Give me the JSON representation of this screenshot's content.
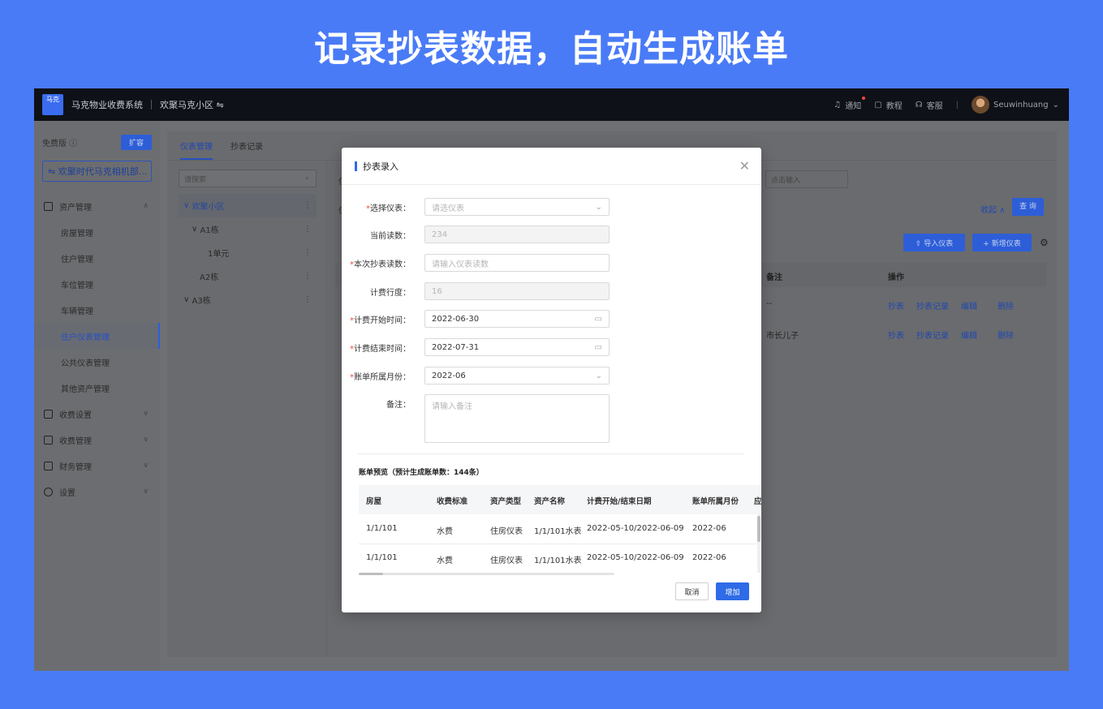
{
  "headline": "记录抄表数据，自动生成账单",
  "topbar": {
    "logo_text": "马克",
    "system_name": "马克物业收费系统",
    "community": "欢聚马克小区 ⇋",
    "notify": "通知",
    "tutorial": "教程",
    "service": "客服",
    "user": "Seuwinhuang"
  },
  "sidebar": {
    "plan": "免费版",
    "expand_btn": "扩容",
    "community_btn": "⇋ 欢聚时代马克相机部...",
    "groups": [
      {
        "label": "资产管理",
        "items": [
          "房屋管理",
          "住户管理",
          "车位管理",
          "车辆管理",
          "住户仪表管理",
          "公共仪表管理",
          "其他资产管理"
        ]
      },
      {
        "label": "收费设置"
      },
      {
        "label": "收费管理"
      },
      {
        "label": "财务管理"
      },
      {
        "label": "设置"
      }
    ]
  },
  "content": {
    "tabs": [
      "仪表管理",
      "抄表记录"
    ],
    "tree_search_placeholder": "请搜索",
    "tree": [
      "欢聚小区",
      "A1栋",
      "1单元",
      "A2栋",
      "A3栋"
    ],
    "filter_label_1": "仪",
    "filter_label_2": "仪",
    "input_placeholder": "点击输入",
    "fold": "收起 ∧",
    "query": "查 询",
    "import_btn": "⇪ 导入仪表",
    "add_btn": "+ 新增仪表",
    "col_remark": "备注",
    "col_ops": "操作",
    "rows": [
      {
        "remark": "--",
        "ops": [
          "抄表",
          "抄表记录",
          "编辑",
          "删除"
        ]
      },
      {
        "remark": "市长儿子",
        "ops": [
          "抄表",
          "抄表记录",
          "编辑",
          "删除"
        ]
      }
    ]
  },
  "modal": {
    "title": "抄表录入",
    "fields": {
      "meter": {
        "label": "选择仪表：",
        "placeholder": "请选仪表"
      },
      "current": {
        "label": "当前读数：",
        "value": "234"
      },
      "reading": {
        "label": "本次抄表读数：",
        "placeholder": "请输入仪表读数"
      },
      "usage": {
        "label": "计费行度：",
        "value": "16"
      },
      "start": {
        "label": "计费开始时间：",
        "value": "2022-06-30"
      },
      "end": {
        "label": "计费结束时间：",
        "value": "2022-07-31"
      },
      "month": {
        "label": "账单所属月份：",
        "value": "2022-06"
      },
      "remark": {
        "label": "备注：",
        "placeholder": "请输入备注"
      }
    },
    "preview_title": "账单预览（预计生成账单数：144条）",
    "preview_headers": [
      "房屋",
      "收费标准",
      "资产类型",
      "资产名称",
      "计费开始/结束日期",
      "账单所属月份",
      "应"
    ],
    "preview_rows": [
      [
        "1/1/101",
        "水费",
        "住房仪表",
        "1/1/101水表",
        "2022-05-10/2022-06-09",
        "2022-06"
      ],
      [
        "1/1/101",
        "水费",
        "住房仪表",
        "1/1/101水表",
        "2022-05-10/2022-06-09",
        "2022-06"
      ]
    ],
    "cancel": "取消",
    "confirm": "增加"
  },
  "colors": {
    "background": "#4a7bf7",
    "primary": "#2e6be6",
    "required": "#f04a3c"
  }
}
